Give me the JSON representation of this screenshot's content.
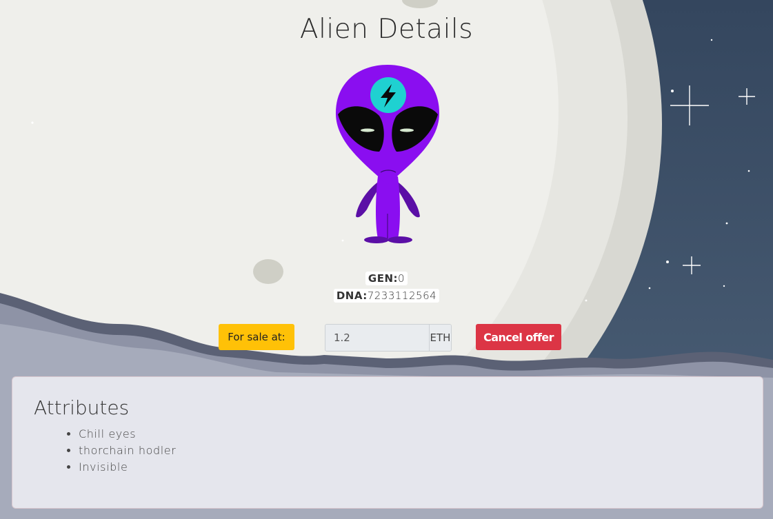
{
  "page": {
    "title": "Alien Details"
  },
  "alien": {
    "gen_label": "GEN:",
    "gen_value": "0",
    "dna_label": "DNA:",
    "dna_value": "7233112564",
    "colors": {
      "body": "#8a0ef0",
      "body_dark": "#5b0fa6",
      "badge": "#1fd1d1",
      "eyes": "#0a0a0a"
    },
    "badge_icon": "thorchain-lightning-icon"
  },
  "sale": {
    "label": "For sale at:",
    "price_value": "1.2",
    "unit": "ETH",
    "cancel_label": "Cancel offer",
    "colors": {
      "label_bg": "#ffc107",
      "cancel_bg": "#dc3545"
    }
  },
  "attributes": {
    "title": "Attributes",
    "items": [
      "Chill eyes",
      "thorchain hodler",
      "Invisible"
    ]
  }
}
